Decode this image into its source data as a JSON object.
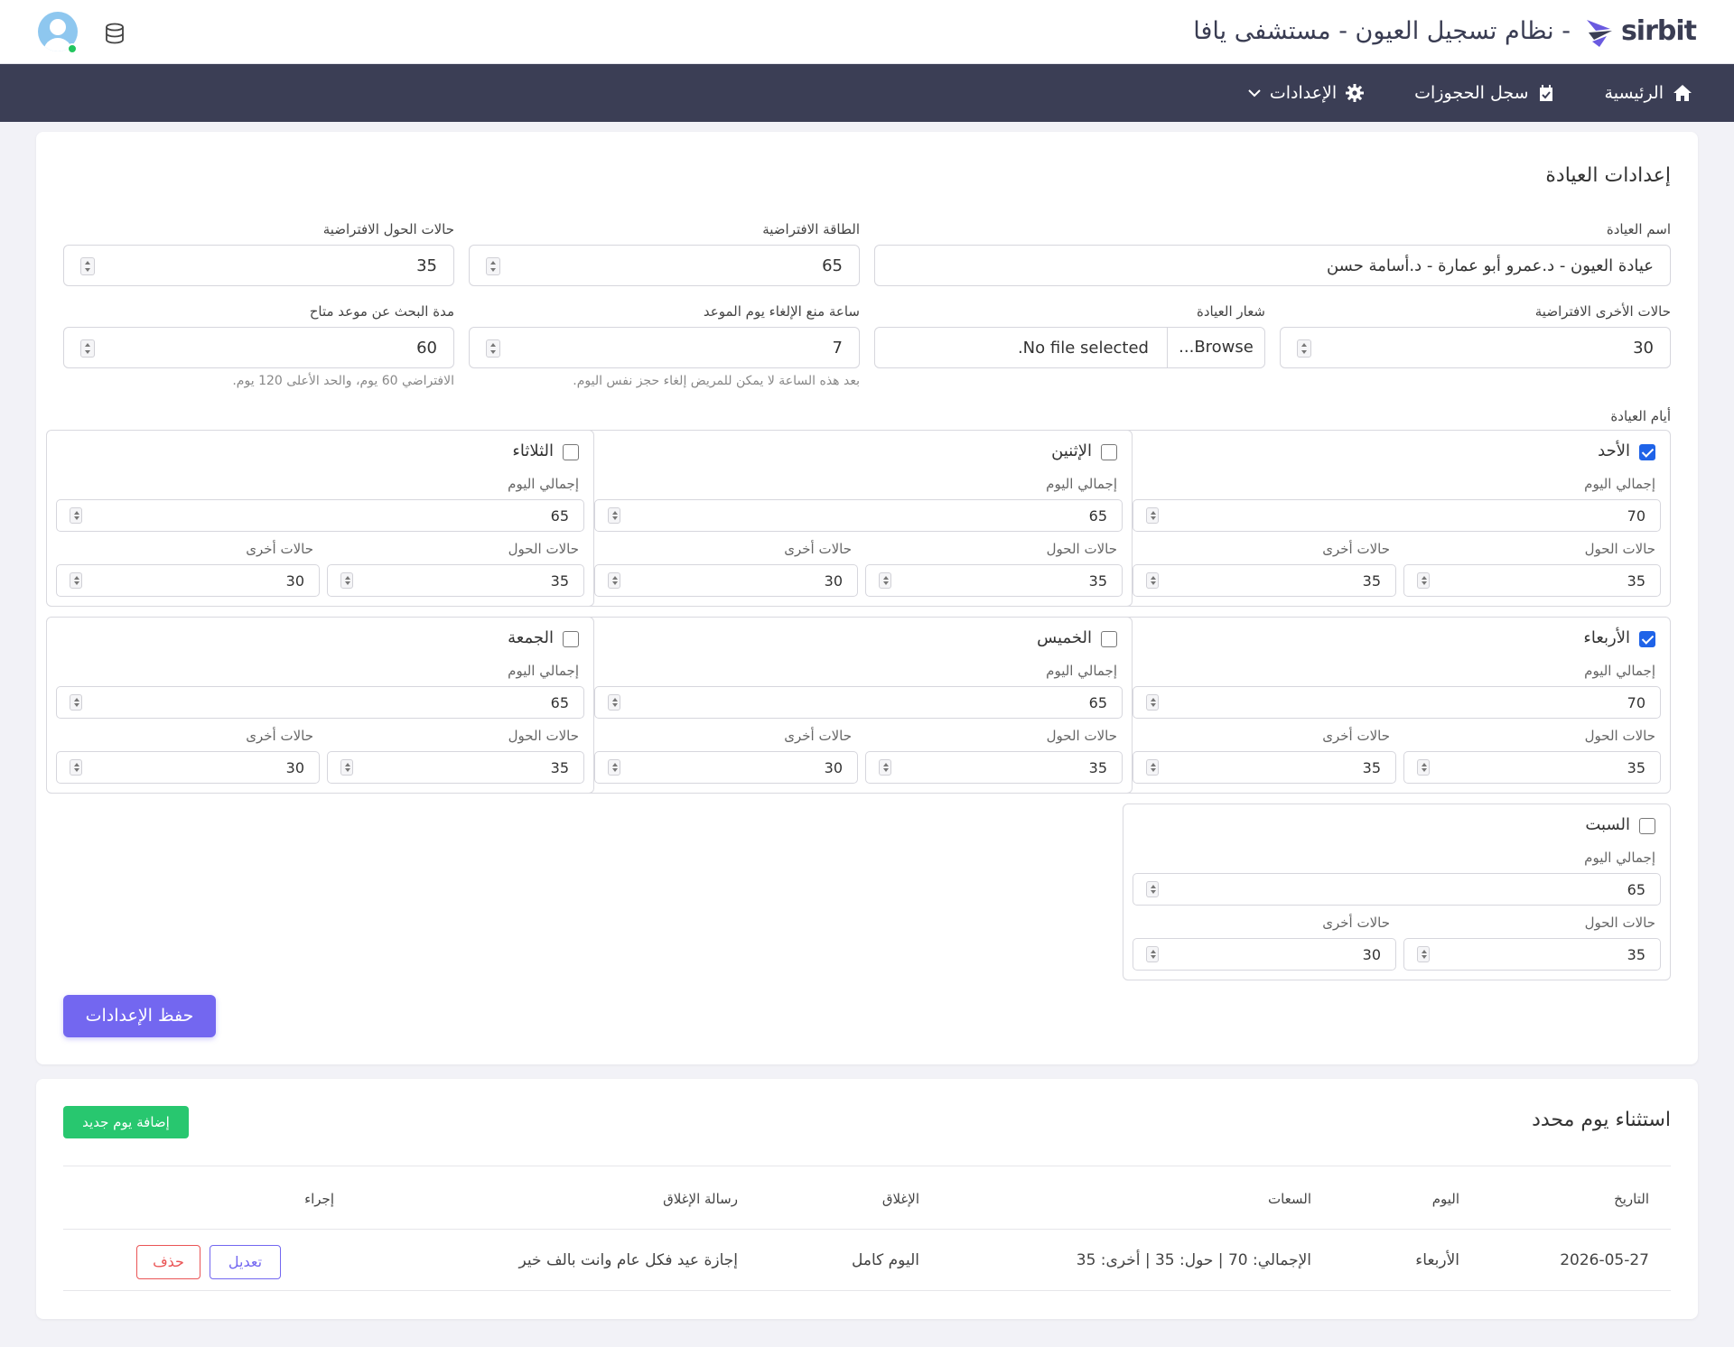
{
  "header": {
    "logo_text": "sirbit",
    "title": "- نظام تسجيل العيون - مستشفى يافا",
    "database_icon": "database-icon",
    "avatar_icon": "user-avatar-icon"
  },
  "nav": {
    "home": "الرئيسية",
    "bookings": "سجل الحجوزات",
    "settings": "الإعدادات"
  },
  "clinic_settings": {
    "title": "إعدادات العيادة",
    "clinic_name_label": "اسم العيادة",
    "clinic_name_value": "عيادة العيون - د.عمرو أبو عمارة - د.أسامة حسن",
    "capacity_label": "الطاقة الافتراضية",
    "capacity_value": "65",
    "referral_label": "حالات الحول الافتراضية",
    "referral_value": "35",
    "other_label": "حالات الأخرى الافتراضية",
    "other_value": "30",
    "logo_label": "شعار العيادة",
    "logo_browse": "Browse...",
    "logo_status": "No file selected.",
    "cancel_hour_label": "ساعة منع الإلغاء يوم الموعد",
    "cancel_hour_value": "7",
    "cancel_hour_help": "بعد هذه الساعة لا يمكن للمريض إلغاء حجز نفس اليوم.",
    "search_days_label": "مدة البحث عن موعد متاح",
    "search_days_value": "60",
    "search_days_help": "الافتراضي 60 يوم، والحد الأعلى 120 يوم.",
    "days_label": "أيام العيادة",
    "total_label": "إجمالي اليوم",
    "referral_short": "حالات الحول",
    "other_short": "حالات أخرى",
    "save": "حفظ الإعدادات"
  },
  "days": [
    {
      "name": "الأحد",
      "checked": true,
      "total": "70",
      "referral": "35",
      "other": "35"
    },
    {
      "name": "الإثنين",
      "checked": false,
      "total": "65",
      "referral": "35",
      "other": "30"
    },
    {
      "name": "الثلاثاء",
      "checked": false,
      "total": "65",
      "referral": "35",
      "other": "30"
    },
    {
      "name": "الأربعاء",
      "checked": true,
      "total": "70",
      "referral": "35",
      "other": "35"
    },
    {
      "name": "الخميس",
      "checked": false,
      "total": "65",
      "referral": "35",
      "other": "30"
    },
    {
      "name": "الجمعة",
      "checked": false,
      "total": "65",
      "referral": "35",
      "other": "30"
    },
    {
      "name": "السبت",
      "checked": false,
      "total": "65",
      "referral": "35",
      "other": "30"
    }
  ],
  "exceptions": {
    "title": "استثناء يوم محدد",
    "add_button": "إضافة يوم جديد",
    "columns": {
      "date": "التاريخ",
      "day": "اليوم",
      "hours": "السعات",
      "closure": "الإغلاق",
      "message": "رسالة الإغلاق",
      "action": "إجراء"
    },
    "rows": [
      {
        "date": "2026-05-27",
        "day": "الأربعاء",
        "hours": "الإجمالي: 70 | حول: 35 | أخرى: 35",
        "closure": "اليوم كامل",
        "message": "إجازة عيد فكل عام وانت بالف خير",
        "edit": "تعديل",
        "delete": "حذف"
      }
    ]
  }
}
